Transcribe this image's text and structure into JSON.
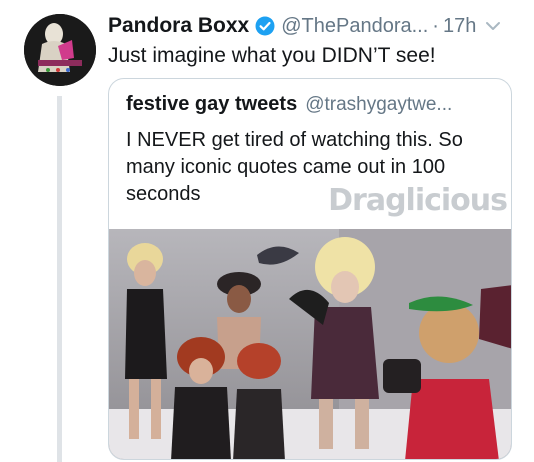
{
  "tweet": {
    "author_name": "Pandora Boxx",
    "author_handle": "@ThePandora...",
    "separator": "·",
    "time": "17h",
    "text": "Just imagine what you DIDN’T see!"
  },
  "quote": {
    "author_name": "festive gay tweets",
    "author_handle": "@trashygaytwe...",
    "text": "I NEVER get tired of watching this. So many iconic quotes came out in 100 seconds",
    "watermark": "Draglicious"
  },
  "icons": {
    "verified": "verified-badge-icon",
    "menu": "chevron-down-icon"
  },
  "colors": {
    "verified_blue": "#1da1f2",
    "secondary_text": "#657786",
    "border": "#ccd6dd"
  }
}
